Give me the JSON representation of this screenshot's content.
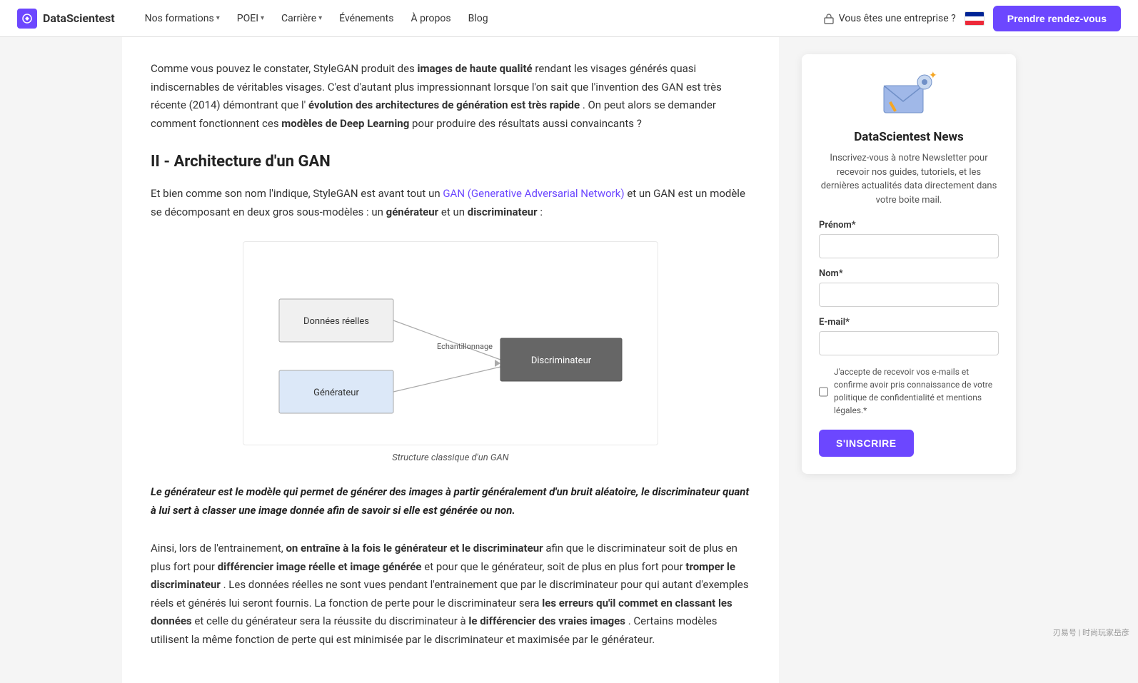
{
  "nav": {
    "logo_text": "DataScientest",
    "items": [
      {
        "label": "Nos formations",
        "has_dropdown": true
      },
      {
        "label": "POEI",
        "has_dropdown": true
      },
      {
        "label": "Carrière",
        "has_dropdown": true
      },
      {
        "label": "Événements",
        "has_dropdown": false
      },
      {
        "label": "À propos",
        "has_dropdown": false
      },
      {
        "label": "Blog",
        "has_dropdown": false
      }
    ],
    "enterprise_label": "Vous êtes une entreprise ?",
    "cta_label": "Prendre rendez-vous"
  },
  "article": {
    "intro": "Comme vous pouvez le constater, StyleGAN produit des ",
    "intro_bold1": "images de haute qualité",
    "intro_cont1": " rendant les visages générés quasi indiscernables de véritables visages. C'est d'autant plus impressionnant lorsque l'on sait que l'invention des GAN est très récente (2014) démontrant que l'",
    "intro_bold2": "évolution des architectures de génération est très rapide",
    "intro_cont2": ". On peut alors se demander comment fonctionnent ces ",
    "intro_bold3": "modèles de Deep Learning",
    "intro_cont3": " pour produire des résultats aussi convaincants ?",
    "section_title": "II - Architecture d'un GAN",
    "section_p1_pre": "Et bien comme son nom l'indique, StyleGAN est avant tout un ",
    "section_p1_link": "GAN (Generative Adversarial Network)",
    "section_p1_post": " et un GAN est un modèle se décomposant en deux gros sous-modèles : un ",
    "section_p1_bold1": "générateur",
    "section_p1_mid": " et un ",
    "section_p1_bold2": "discriminateur",
    "section_p1_end": " :",
    "diagram": {
      "node_real": "Données réelles",
      "node_gen": "Générateur",
      "node_disc": "Discriminateur",
      "arrow_label": "Echantillonnage",
      "caption": "Structure classique d'un GAN"
    },
    "key_text": "Le générateur est le modèle qui permet de générer des images à partir généralement d'un bruit aléatoire, le discriminateur quant à lui sert à classer une image donnée afin de savoir si elle est générée ou non.",
    "bottom_p1_pre": "Ainsi, lors de l'entrainement, ",
    "bottom_p1_bold": "on entraîne à la fois le générateur et le discriminateur",
    "bottom_p1_post": " afin que le discriminateur soit de plus en plus fort pour ",
    "bottom_p1_bold2": "différencier image réelle et image générée",
    "bottom_p1_cont": " et pour que le générateur, soit de plus en plus fort pour ",
    "bottom_p1_bold3": "tromper le discriminateur",
    "bottom_p1_end": ". Les données réelles ne sont vues pendant l'entrainement que par le discriminateur pour qui autant d'exemples réels et générés lui seront fournis. La fonction de perte pour le discriminateur sera ",
    "bottom_p1_bold4": "les erreurs qu'il commet en classant les données",
    "bottom_p1_end2": " et celle du générateur sera la réussite du discriminateur à ",
    "bottom_p1_bold5": "le différencier des vraies images",
    "bottom_p1_end3": ". Certains modèles utilisent la même fonction de perte qui est minimisée par le discriminateur et maximisée par le générateur."
  },
  "newsletter": {
    "title": "DataScientest News",
    "description": "Inscrivez-vous à notre Newsletter pour recevoir nos guides, tutoriels, et les dernières actualités data directement dans votre boite mail.",
    "prenom_label": "Prénom*",
    "prenom_placeholder": "",
    "nom_label": "Nom*",
    "nom_placeholder": "",
    "email_label": "E-mail*",
    "email_placeholder": "",
    "checkbox_label": "J'accepte de recevoir vos e-mails et confirme avoir pris connaissance de votre politique de confidentialité et mentions légales.*",
    "subscribe_btn": "S'INSCRIRE"
  },
  "watermark": "刃易号 | 时尚玩家岳彦"
}
